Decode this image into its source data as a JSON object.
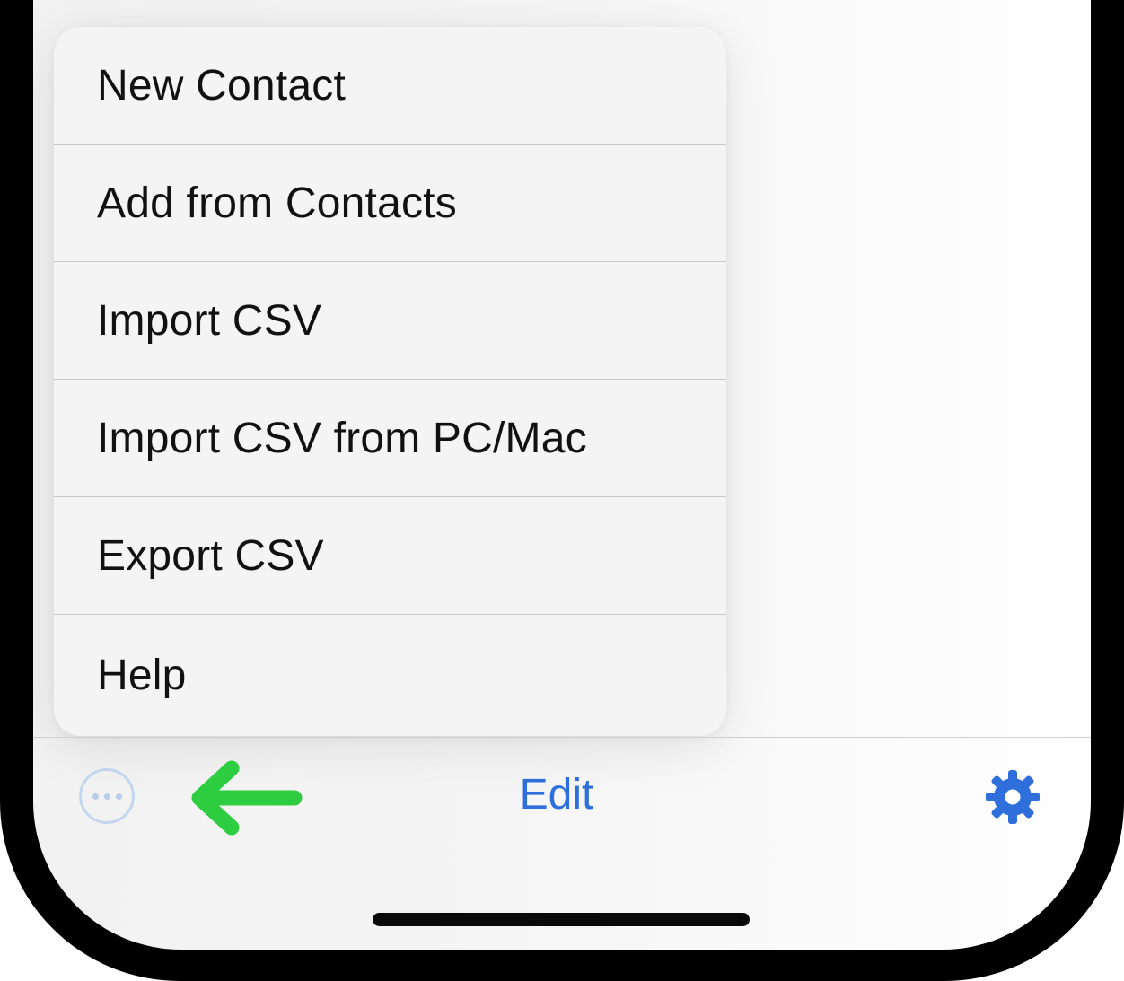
{
  "menu": {
    "items": [
      {
        "label": "New Contact"
      },
      {
        "label": "Add from Contacts"
      },
      {
        "label": "Import CSV"
      },
      {
        "label": "Import CSV from PC/Mac"
      },
      {
        "label": "Export CSV"
      },
      {
        "label": "Help"
      }
    ]
  },
  "toolbar": {
    "more_icon": "ellipsis-circle-icon",
    "edit_label": "Edit",
    "settings_icon": "gear-icon"
  },
  "annotation": {
    "arrow_icon": "arrow-left-icon",
    "arrow_color": "#2ecc40"
  },
  "colors": {
    "accent": "#2f6fdc",
    "more_icon": "#b9cde8"
  }
}
